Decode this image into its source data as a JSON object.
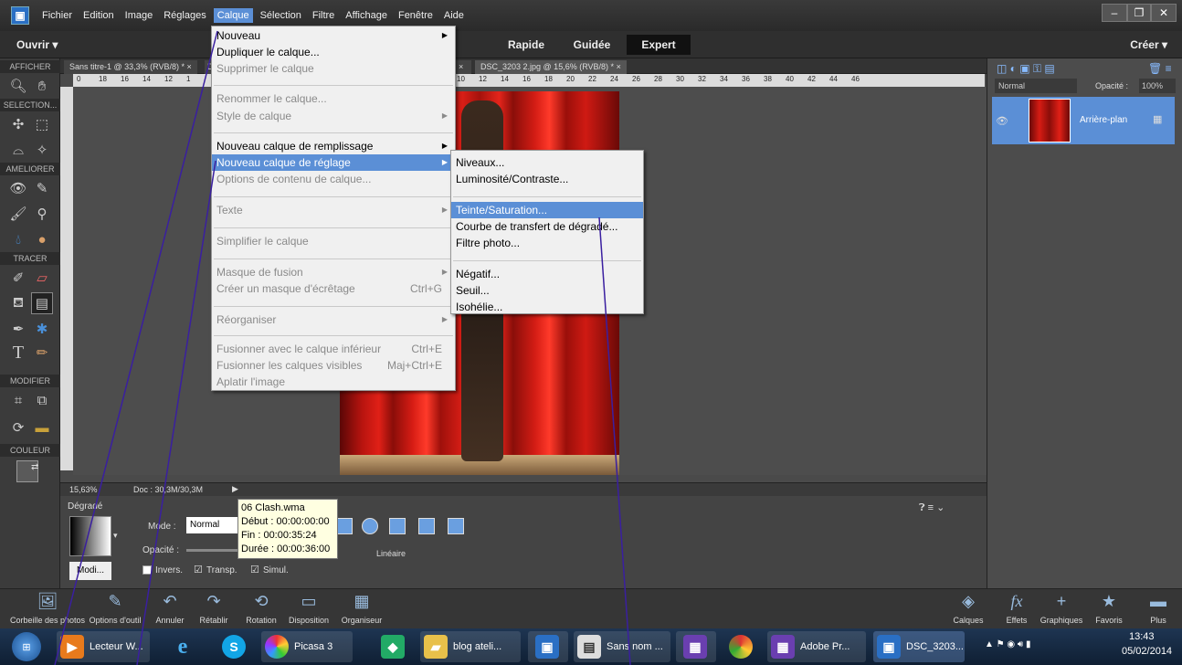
{
  "menubar": {
    "items": [
      "Fichier",
      "Edition",
      "Image",
      "Réglages",
      "Calque",
      "Sélection",
      "Filtre",
      "Affichage",
      "Fenêtre",
      "Aide"
    ],
    "active": "Calque"
  },
  "topbar": {
    "open": "Ouvrir",
    "modes": [
      "Rapide",
      "Guidée",
      "Expert"
    ],
    "active_mode": "Expert",
    "create": "Créer"
  },
  "toolbar": {
    "sections": [
      "AFFICHER",
      "SELECTION...",
      "AMELIORER",
      "TRACER",
      "MODIFIER",
      "COULEUR"
    ]
  },
  "tabs": {
    "tab1": "Sans titre-1 @ 33,3% (RVB/8) *",
    "tab1_close": "×",
    "tab2_prefix": "D",
    "tab3_close": "×",
    "tab4": "DSC_3203 2.jpg @ 15,6% (RVB/8) *",
    "tab4_close": "×"
  },
  "ruler_h": [
    "0",
    "18",
    "16",
    "14",
    "12",
    "1",
    "10",
    "12",
    "14",
    "16",
    "18",
    "20",
    "22",
    "24",
    "26",
    "28",
    "30",
    "32",
    "34",
    "36",
    "38",
    "40",
    "42",
    "44",
    "46"
  ],
  "status": {
    "zoom": "15,63%",
    "doc": "Doc : 30,3M/30,3M"
  },
  "options": {
    "title": "Dégradé",
    "mode_label": "Mode :",
    "mode_value": "Normal",
    "opacity_label": "Opacité :",
    "modify": "Modi...",
    "invert": "Invers.",
    "transp": "Transp.",
    "simul": "Simul.",
    "linear": "Linéaire"
  },
  "tooltip": {
    "lines": [
      "06 Clash.wma",
      "Début : 00:00:00:00",
      "Fin : 00:00:35:24",
      "Durée : 00:00:36:00"
    ]
  },
  "layers": {
    "blend": "Normal",
    "opacity_label": "Opacité :",
    "opacity_value": "100%",
    "layer_name": "Arrière-plan"
  },
  "calque_menu": {
    "items": [
      {
        "label": "Nouveau",
        "disabled": false,
        "arrow": true
      },
      {
        "label": "Dupliquer le calque...",
        "disabled": false
      },
      {
        "label": "Supprimer le calque",
        "disabled": true
      },
      {
        "label": "Renommer le calque...",
        "disabled": true
      },
      {
        "label": "Style de calque",
        "disabled": true,
        "arrow": true
      },
      {
        "label": "Nouveau calque de remplissage",
        "disabled": false,
        "arrow": true
      },
      {
        "label": "Nouveau calque de réglage",
        "disabled": false,
        "arrow": true,
        "highlight": true
      },
      {
        "label": "Options de contenu de calque...",
        "disabled": true
      },
      {
        "label": "Texte",
        "disabled": true,
        "arrow": true
      },
      {
        "label": "Simplifier le calque",
        "disabled": true
      },
      {
        "label": "Masque de fusion",
        "disabled": true,
        "arrow": true
      },
      {
        "label": "Créer un masque d'écrêtage",
        "disabled": true,
        "shortcut": "Ctrl+G"
      },
      {
        "label": "Réorganiser",
        "disabled": true,
        "arrow": true
      },
      {
        "label": "Fusionner avec le calque inférieur",
        "disabled": true,
        "shortcut": "Ctrl+E"
      },
      {
        "label": "Fusionner les calques visibles",
        "disabled": true,
        "shortcut": "Maj+Ctrl+E"
      },
      {
        "label": "Aplatir l'image",
        "disabled": true
      }
    ]
  },
  "submenu": {
    "items": [
      "Niveaux...",
      "Luminosité/Contraste...",
      "Teinte/Saturation...",
      "Courbe de transfert de dégradé...",
      "Filtre photo...",
      "Négatif...",
      "Seuil...",
      "Isohélie..."
    ],
    "highlight": "Teinte/Saturation..."
  },
  "bottombar": {
    "items": [
      "Corbeille des photos",
      "Options d'outil",
      "Annuler",
      "Rétablir",
      "Rotation",
      "Disposition",
      "Organiseur",
      "Calques",
      "Effets",
      "Graphiques",
      "Favoris",
      "Plus"
    ]
  },
  "taskbar": {
    "items": [
      "Lecteur W...",
      "Picasa 3",
      "blog ateli...",
      "Sans nom ...",
      "Adobe Pr...",
      "DSC_3203..."
    ],
    "time": "13:43",
    "date": "05/02/2014"
  },
  "colors": {
    "accent": "#5b8fd6",
    "menu_bg": "#f0f0f0",
    "ui_dark": "#3b3b3b",
    "taskbar": "#1e3552"
  }
}
